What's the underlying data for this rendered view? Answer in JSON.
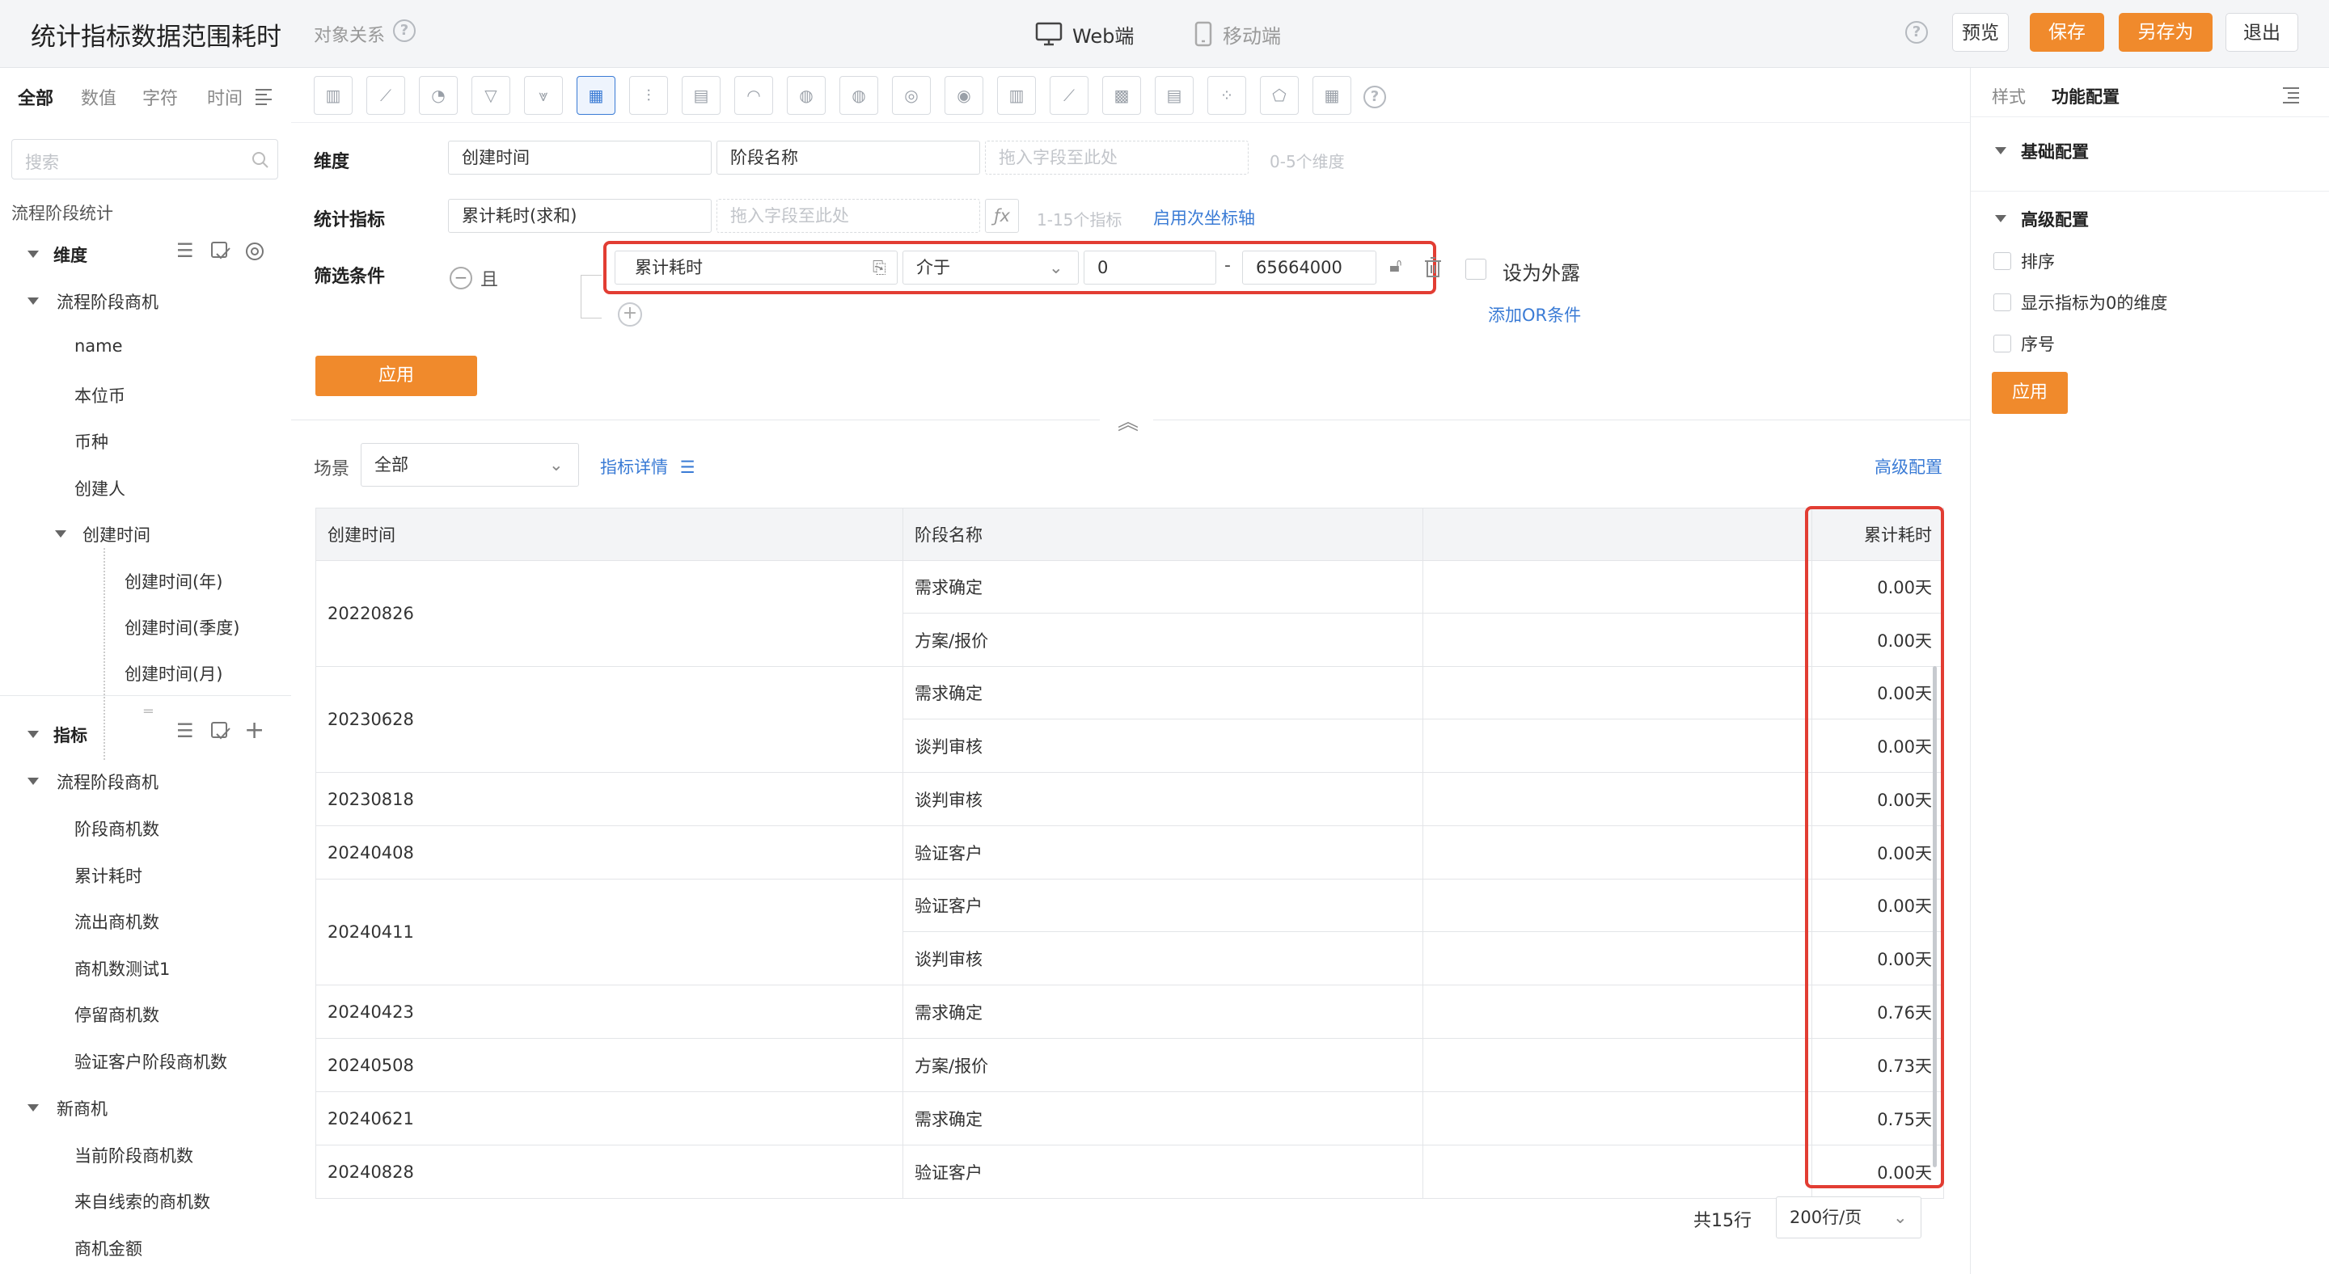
{
  "header": {
    "title": "统计指标数据范围耗时",
    "relation_link": "对象关系",
    "mode_web": "Web端",
    "mode_mobile": "移动端",
    "btn_preview": "预览",
    "btn_save": "保存",
    "btn_save_as": "另存为",
    "btn_exit": "退出"
  },
  "left_panel": {
    "tabs": [
      "全部",
      "数值",
      "字符",
      "时间"
    ],
    "search_placeholder": "搜索",
    "dataset_name": "流程阶段统计",
    "dimension_header": "维度",
    "dimension_group": "流程阶段商机",
    "dimension_fields": [
      "name",
      "本位币",
      "币种",
      "创建人"
    ],
    "date_field": "创建时间",
    "date_subfields": [
      "创建时间(年)",
      "创建时间(季度)",
      "创建时间(月)"
    ],
    "metric_header": "指标",
    "metric_group1": "流程阶段商机",
    "metric_group1_items": [
      "阶段商机数",
      "累计耗时",
      "流出商机数",
      "商机数测试1",
      "停留商机数",
      "验证客户阶段商机数"
    ],
    "metric_group2": "新商机",
    "metric_group2_items": [
      "当前阶段商机数",
      "来自线索的商机数",
      "商机金额"
    ]
  },
  "config": {
    "dimension_label": "维度",
    "dimension_fields": [
      "创建时间",
      "阶段名称"
    ],
    "drop_placeholder": "拖入字段至此处",
    "dimension_hint": "0-5个维度",
    "metric_label": "统计指标",
    "metric_field": "累计耗时(求和)",
    "metric_drop_placeholder": "拖入字段至此处",
    "metric_hint": "1-15个指标",
    "secondary_axis_link": "启用次坐标轴",
    "filter_label": "筛选条件",
    "filter_logic": "且",
    "filter_field": "累计耗时",
    "filter_operator": "介于",
    "filter_from": "0",
    "filter_dash": "-",
    "filter_to": "65664000",
    "expose_label": "设为外露",
    "add_or_link": "添加OR条件",
    "apply_button": "应用"
  },
  "scene": {
    "label": "场景",
    "value": "全部",
    "detail_link": "指标详情",
    "advanced_link": "高级配置"
  },
  "table": {
    "headers": [
      "创建时间",
      "阶段名称",
      "",
      "累计耗时"
    ],
    "groups": [
      {
        "date": "20220826",
        "rows": [
          {
            "stage": "需求确定",
            "value": "0.00天"
          },
          {
            "stage": "方案/报价",
            "value": "0.00天"
          }
        ]
      },
      {
        "date": "20230628",
        "rows": [
          {
            "stage": "需求确定",
            "value": "0.00天"
          },
          {
            "stage": "谈判审核",
            "value": "0.00天"
          }
        ]
      },
      {
        "date": "20230818",
        "rows": [
          {
            "stage": "谈判审核",
            "value": "0.00天"
          }
        ]
      },
      {
        "date": "20240408",
        "rows": [
          {
            "stage": "验证客户",
            "value": "0.00天"
          }
        ]
      },
      {
        "date": "20240411",
        "rows": [
          {
            "stage": "验证客户",
            "value": "0.00天"
          },
          {
            "stage": "谈判审核",
            "value": "0.00天"
          }
        ]
      },
      {
        "date": "20240423",
        "rows": [
          {
            "stage": "需求确定",
            "value": "0.76天"
          }
        ]
      },
      {
        "date": "20240508",
        "rows": [
          {
            "stage": "方案/报价",
            "value": "0.73天"
          }
        ]
      },
      {
        "date": "20240621",
        "rows": [
          {
            "stage": "需求确定",
            "value": "0.75天"
          }
        ]
      },
      {
        "date": "20240828",
        "rows": [
          {
            "stage": "验证客户",
            "value": "0.00天"
          }
        ]
      }
    ],
    "total_text": "共15行",
    "page_size": "200行/页"
  },
  "right_panel": {
    "tab_style": "样式",
    "tab_function": "功能配置",
    "basic_section": "基础配置",
    "advanced_section": "高级配置",
    "options": [
      "排序",
      "显示指标为0的维度",
      "序号"
    ],
    "apply_button": "应用"
  },
  "colors": {
    "accent_orange": "#f08a2c",
    "link_blue": "#3a7bd5",
    "highlight_red": "#e23d33"
  }
}
